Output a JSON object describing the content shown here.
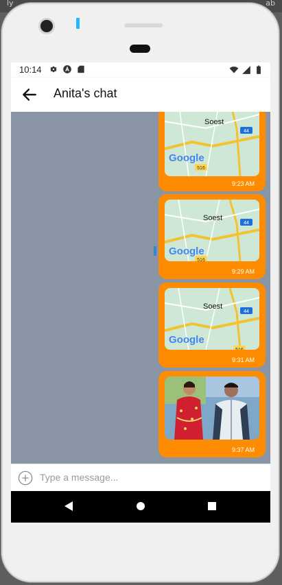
{
  "desktop": {
    "left_text": "ly",
    "right_text": "ab"
  },
  "status_bar": {
    "time": "10:14",
    "left_icons": [
      "gear-icon",
      "a-circle-icon",
      "sd-card-icon"
    ],
    "right_icons": [
      "wifi-icon",
      "signal-icon",
      "battery-icon"
    ]
  },
  "app_bar": {
    "title": "Anita's chat",
    "back_icon": "arrow-left-icon"
  },
  "colors": {
    "bubble": "#ff8c00",
    "chat_background": "#8994a4",
    "accent_sensor": "#29b6f6"
  },
  "messages": [
    {
      "type": "map",
      "map_place": "Soest",
      "road_a": "44",
      "road_b": "516",
      "brand": "Google",
      "time": "9:23 AM"
    },
    {
      "type": "map",
      "map_place": "Soest",
      "road_a": "44",
      "road_b": "516",
      "brand": "Google",
      "time": "9:29 AM"
    },
    {
      "type": "map",
      "map_place": "Soest",
      "road_a": "44",
      "road_b": "516",
      "brand": "Google",
      "time": "9:31 AM"
    },
    {
      "type": "photo",
      "time": "9:37 AM"
    }
  ],
  "composer": {
    "placeholder": "Type a message...",
    "value": "",
    "add_icon": "plus-circle-icon"
  },
  "nav": {
    "icons": [
      "nav-back-icon",
      "nav-home-icon",
      "nav-recents-icon"
    ]
  }
}
